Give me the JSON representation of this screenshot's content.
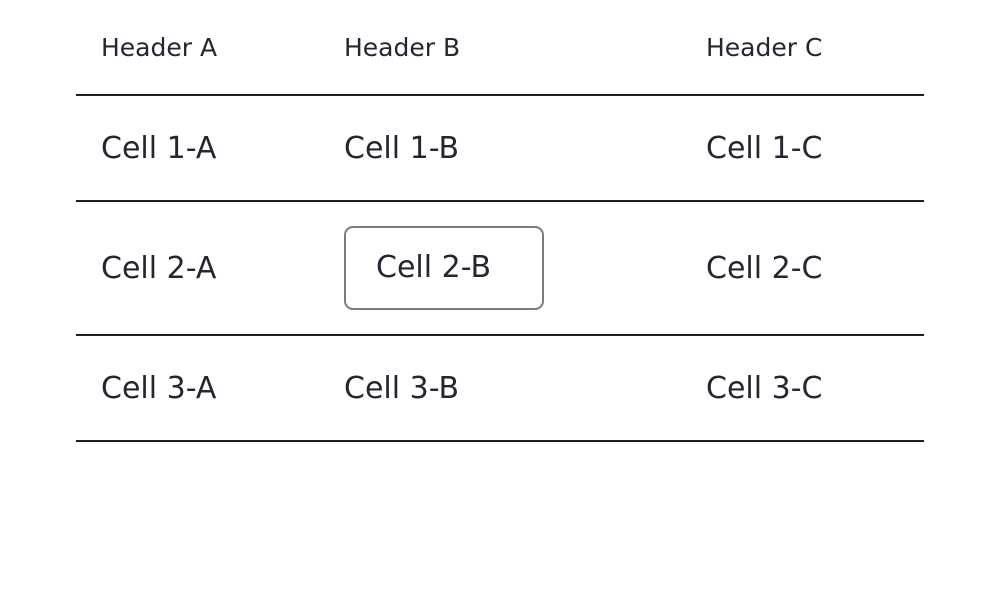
{
  "table": {
    "headers": [
      "Header A",
      "Header B",
      "Header C"
    ],
    "rows": [
      [
        "Cell 1-A",
        "Cell 1-B",
        "Cell 1-C"
      ],
      [
        "Cell 2-A",
        "Cell 2-B",
        "Cell 2-C"
      ],
      [
        "Cell 3-A",
        "Cell 3-B",
        "Cell 3-C"
      ]
    ],
    "editing_cell_value": "Cell 2-B"
  }
}
